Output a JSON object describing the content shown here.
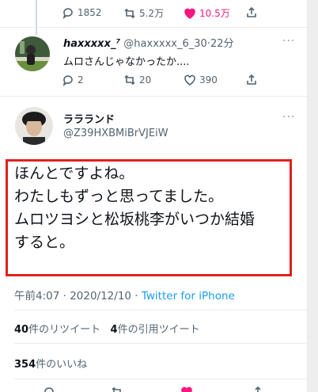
{
  "top_actions": {
    "reply_count": "1852",
    "retweet_count": "5.2万",
    "like_count": "10.5万"
  },
  "reply": {
    "display_name": "haxxxxx_⁷",
    "handle": "@haxxxxx_6_30",
    "separator": "·",
    "time": "22分",
    "text": "ムロさんじゃなかったか....",
    "reply_count": "2",
    "retweet_count": "20",
    "like_count": "390"
  },
  "main": {
    "display_name": "ララランド",
    "handle": "@Z39HXBMiBrVJEiW",
    "text_lines": [
      "ほんとですよね。",
      "わたしもずっと思ってました。",
      "ムロツヨシと松坂桃李がいつか結婚",
      "すると。"
    ],
    "timestamp": "午前4:07 · 2020/12/10 · ",
    "source": "Twitter for iPhone",
    "retweets_num": "40",
    "retweets_label": "件のリツイート",
    "quotes_num": "4",
    "quotes_label": "件の引用ツイート",
    "likes_num": "354",
    "likes_label": "件のいいね"
  },
  "more_label": "···",
  "colors": {
    "accent": "#1d9bf0",
    "like": "#f91880",
    "highlight": "#e0201e"
  }
}
